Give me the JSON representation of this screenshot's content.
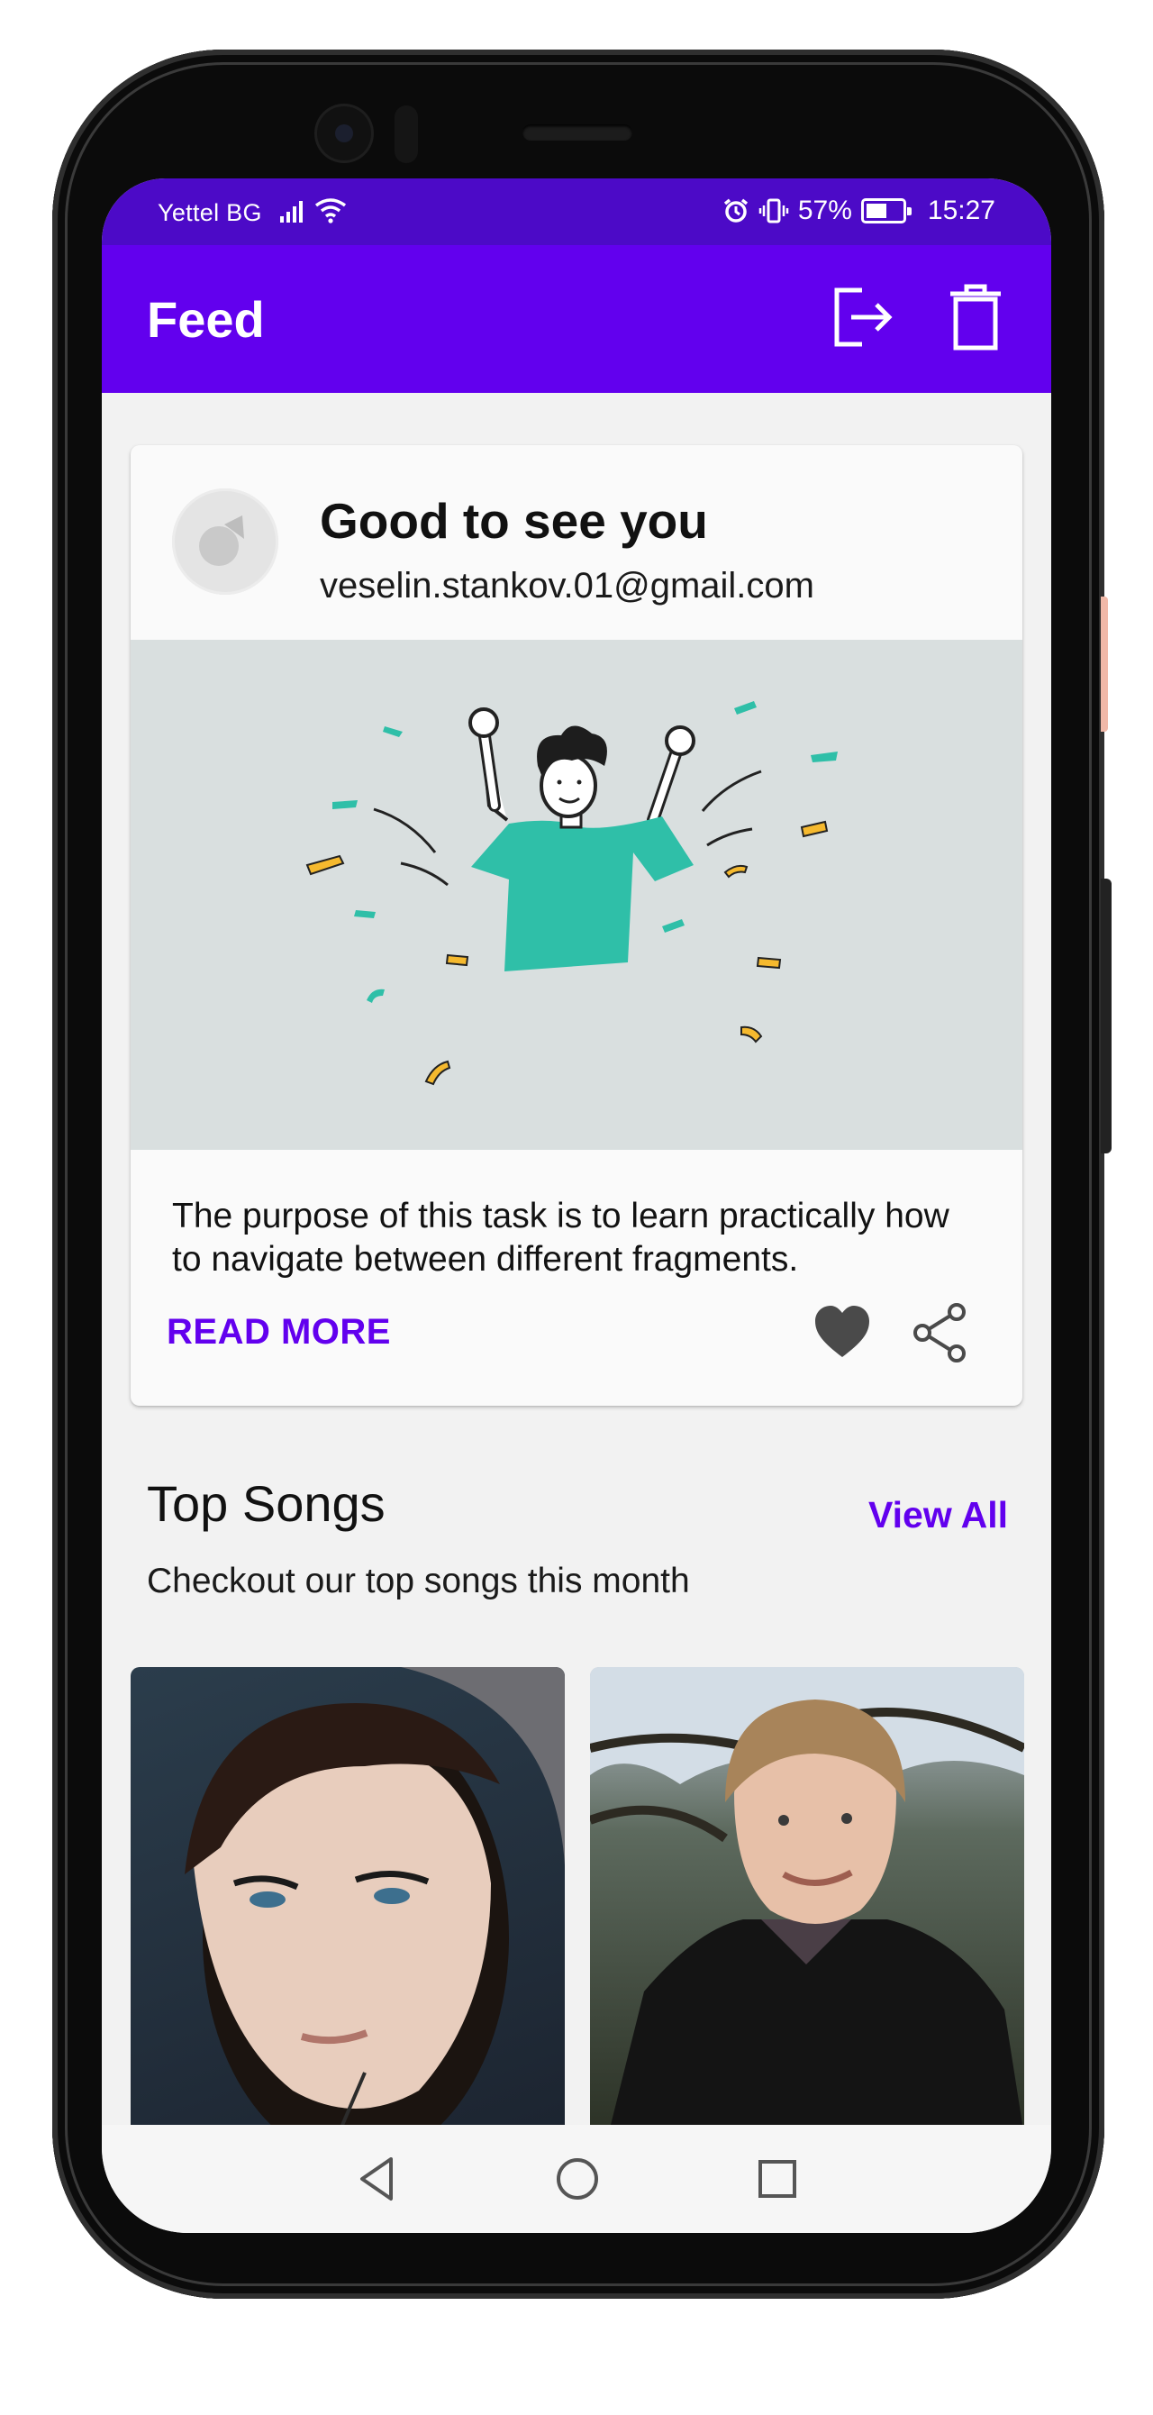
{
  "status_bar": {
    "carrier": "Yettel BG",
    "battery_percent": "57%",
    "time": "15:27"
  },
  "app_bar": {
    "title": "Feed",
    "icons": [
      "logout-icon",
      "delete-icon"
    ]
  },
  "welcome_card": {
    "heading": "Good to see you",
    "email": "veselin.stankov.01@gmail.com",
    "description": "The purpose of this task is to learn practically how to navigate between different fragments.",
    "read_more_label": "READ MORE",
    "icons": [
      "heart-icon",
      "share-icon"
    ]
  },
  "top_songs": {
    "title": "Top Songs",
    "view_all_label": "View All",
    "subtitle": "Checkout our top songs this month"
  },
  "nav_bar": {
    "icons": [
      "back-icon",
      "home-icon",
      "recents-icon"
    ]
  },
  "colors": {
    "status_bar": "#4c0ac7",
    "primary": "#6200ee",
    "illustration_teal": "#2fbfa8",
    "confetti_yellow": "#f5b92e"
  }
}
